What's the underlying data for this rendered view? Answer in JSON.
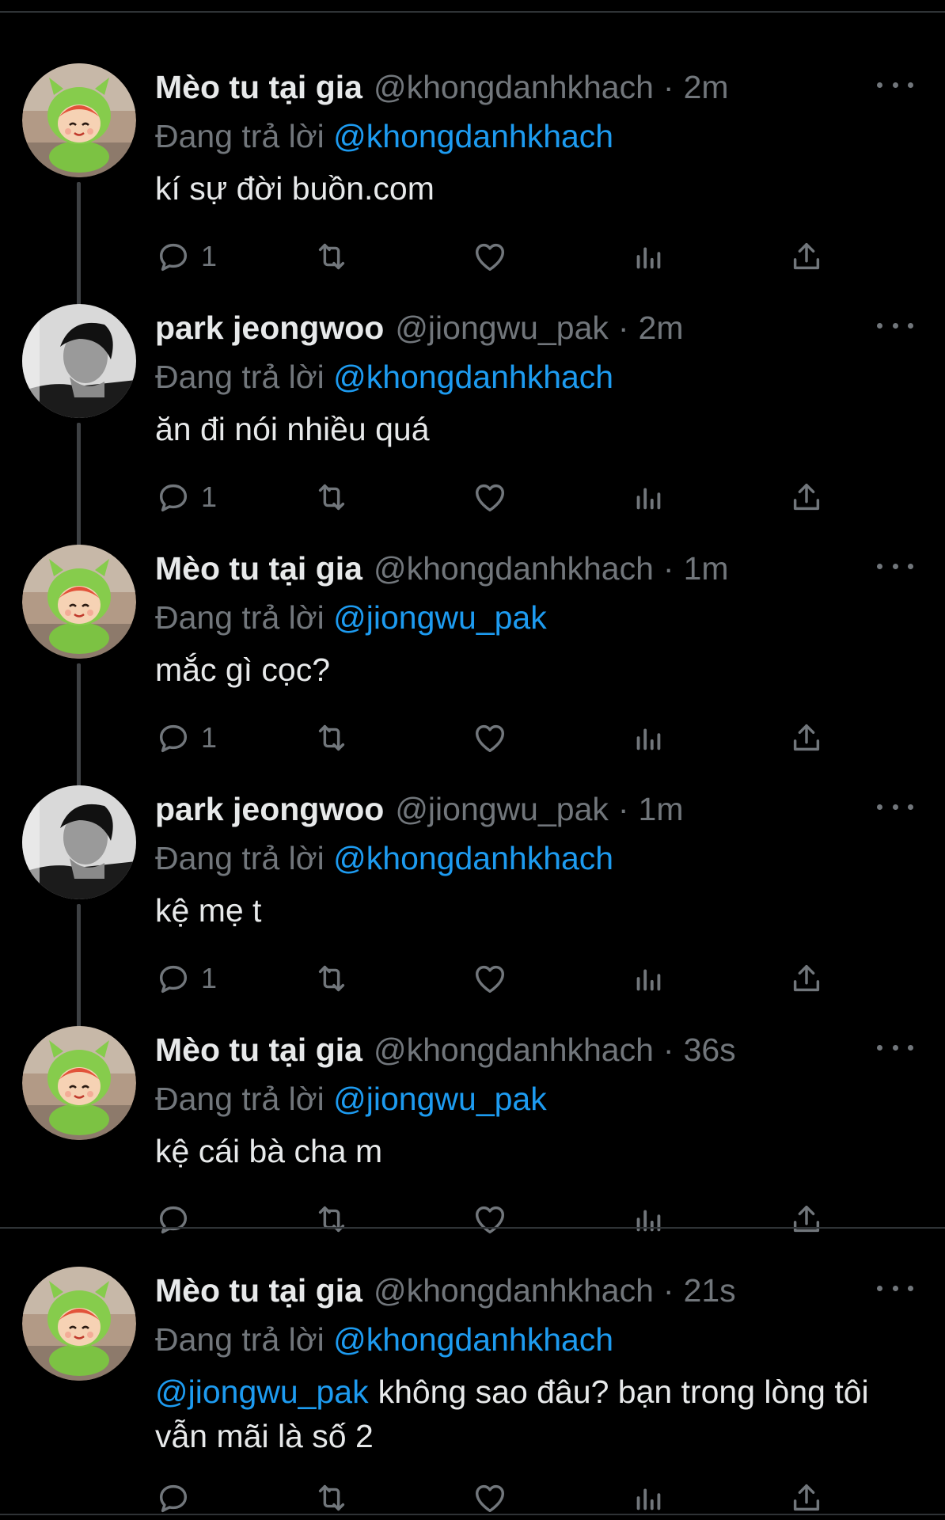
{
  "reply_prefix": "Đang trả lời",
  "tweets": [
    {
      "name": "Mèo tu tại gia",
      "handle": "@khongdanhkhach",
      "time": "2m",
      "replying_to": "@khongdanhkhach",
      "mention": "",
      "text": "kí sự đời buồn.com",
      "reply_count": "1",
      "avatar": "green-mascot-avatar"
    },
    {
      "name": "park jeongwoo",
      "handle": "@jiongwu_pak",
      "time": "2m",
      "replying_to": "@khongdanhkhach",
      "mention": "",
      "text": "ăn đi nói nhiều quá",
      "reply_count": "1",
      "avatar": "bw-portrait-avatar"
    },
    {
      "name": "Mèo tu tại gia",
      "handle": "@khongdanhkhach",
      "time": "1m",
      "replying_to": "@jiongwu_pak",
      "mention": "",
      "text": "mắc gì cọc?",
      "reply_count": "1",
      "avatar": "green-mascot-avatar"
    },
    {
      "name": "park jeongwoo",
      "handle": "@jiongwu_pak",
      "time": "1m",
      "replying_to": "@khongdanhkhach",
      "mention": "",
      "text": "kệ mẹ t",
      "reply_count": "1",
      "avatar": "bw-portrait-avatar"
    },
    {
      "name": "Mèo tu tại gia",
      "handle": "@khongdanhkhach",
      "time": "36s",
      "replying_to": "@jiongwu_pak",
      "mention": "",
      "text": "kệ cái bà cha m",
      "reply_count": "",
      "avatar": "green-mascot-avatar"
    },
    {
      "name": "Mèo tu tại gia",
      "handle": "@khongdanhkhach",
      "time": "21s",
      "replying_to": "@khongdanhkhach",
      "mention": "@jiongwu_pak",
      "text": "không sao đâu? bạn trong lòng tôi vẫn mãi là số 2",
      "reply_count": "",
      "avatar": "green-mascot-avatar"
    }
  ],
  "colors": {
    "background": "#000000",
    "text": "#e7e9ea",
    "muted": "#71767b",
    "accent": "#1d9bf0",
    "divider": "#2f3336"
  },
  "icons": [
    "reply-icon",
    "retweet-icon",
    "like-icon",
    "views-icon",
    "share-icon",
    "more-icon"
  ]
}
